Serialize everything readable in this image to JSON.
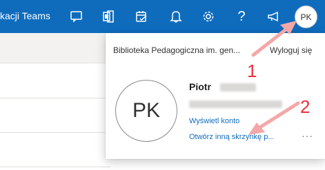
{
  "topbar": {
    "app_title": "kacji Teams",
    "icons": [
      "chat-icon",
      "office-icon",
      "tasks-icon",
      "bell-icon",
      "gear-icon",
      "help-icon",
      "megaphone-icon"
    ],
    "help_glyph": "?",
    "avatar_initials": "PK"
  },
  "panel": {
    "org_name": "Biblioteka Pedagogiczna im. gen...",
    "sign_out": "Wyloguj się",
    "avatar_initials": "PK",
    "user_first_name": "Piotr",
    "view_account": "Wyświetl konto",
    "open_other_mailbox": "Otwórz inną skrzynkę p...",
    "more": "···"
  },
  "annotations": {
    "step1": "1",
    "step2": "2",
    "arrow_color": "#f4a7a7",
    "number_color": "#e8313a"
  },
  "colors": {
    "brand": "#0f6cbd",
    "link": "#0f6cbd"
  }
}
